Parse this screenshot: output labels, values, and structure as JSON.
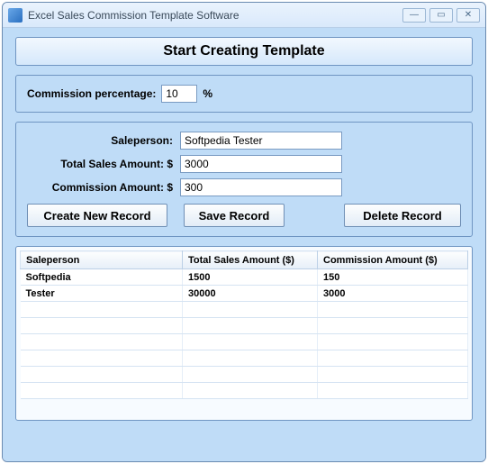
{
  "window": {
    "title": "Excel Sales Commission Template Software"
  },
  "header": {
    "main_title": "Start Creating Template"
  },
  "commission": {
    "label": "Commission percentage:",
    "value": "10",
    "suffix": "%"
  },
  "form": {
    "salesperson_label": "Saleperson:",
    "salesperson_value": "Softpedia Tester",
    "total_sales_label": "Total Sales Amount: $",
    "total_sales_value": "3000",
    "commission_amount_label": "Commission Amount: $",
    "commission_amount_value": "300"
  },
  "buttons": {
    "create": "Create New Record",
    "save": "Save Record",
    "delete": "Delete Record"
  },
  "table": {
    "headers": [
      "Saleperson",
      "Total Sales Amount ($)",
      "Commission Amount ($)"
    ],
    "rows": [
      {
        "salesperson": "Softpedia",
        "total": "1500",
        "commission": "150"
      },
      {
        "salesperson": "Tester",
        "total": "30000",
        "commission": "3000"
      }
    ]
  }
}
